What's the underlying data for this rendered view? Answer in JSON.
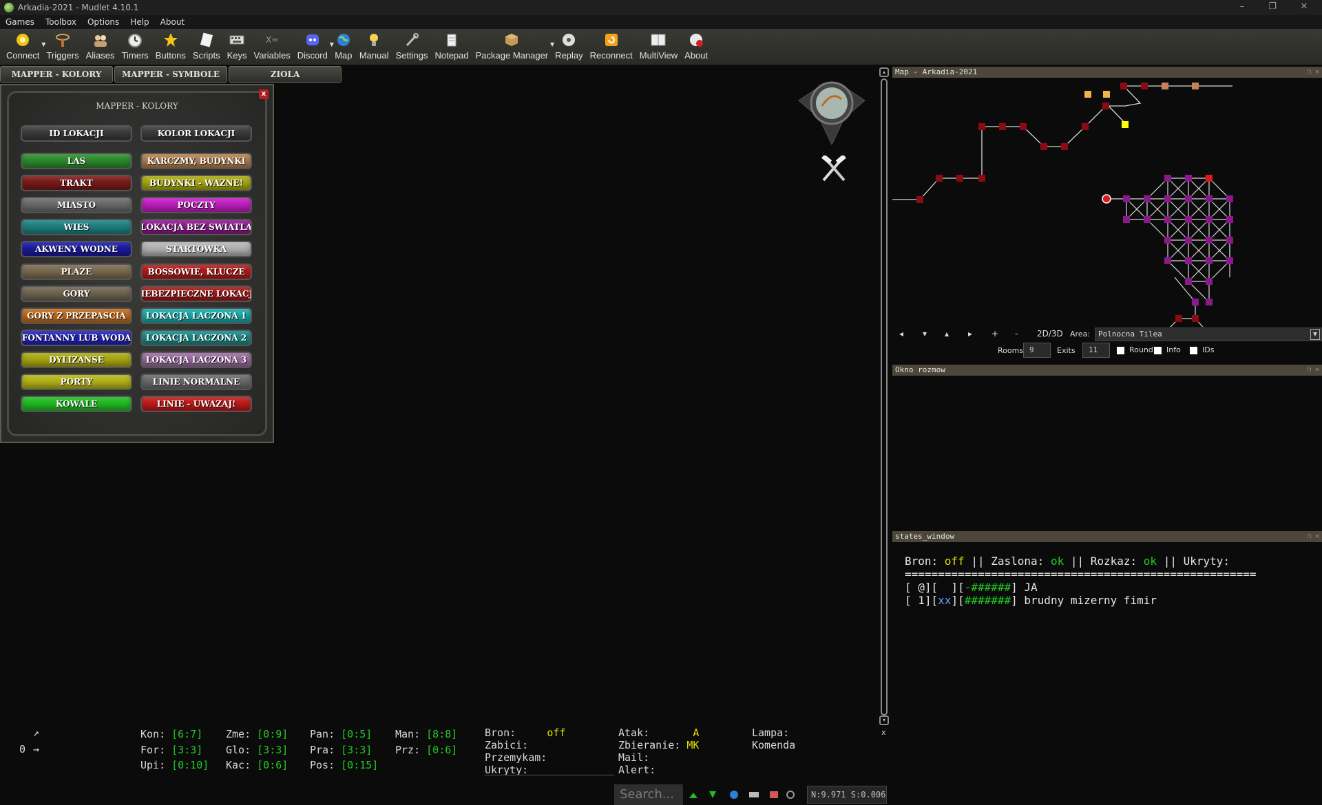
{
  "window": {
    "title": "Arkadia-2021 - Mudlet 4.10.1",
    "minimize": "–",
    "maximize": "❐",
    "close": "✕"
  },
  "menu": [
    "Games",
    "Toolbox",
    "Options",
    "Help",
    "About"
  ],
  "toolbar": [
    {
      "label": "Connect",
      "icon": "connect-icon"
    },
    {
      "label": "Triggers",
      "icon": "triggers-icon"
    },
    {
      "label": "Aliases",
      "icon": "aliases-icon"
    },
    {
      "label": "Timers",
      "icon": "timers-icon"
    },
    {
      "label": "Buttons",
      "icon": "buttons-icon"
    },
    {
      "label": "Scripts",
      "icon": "scripts-icon"
    },
    {
      "label": "Keys",
      "icon": "keys-icon"
    },
    {
      "label": "Variables",
      "icon": "variables-icon"
    },
    {
      "label": "Discord",
      "icon": "discord-icon"
    },
    {
      "label": "Map",
      "icon": "map-icon"
    },
    {
      "label": "Manual",
      "icon": "manual-icon"
    },
    {
      "label": "Settings",
      "icon": "settings-icon"
    },
    {
      "label": "Notepad",
      "icon": "notepad-icon"
    },
    {
      "label": "Package Manager",
      "icon": "package-icon"
    },
    {
      "label": "Replay",
      "icon": "replay-icon"
    },
    {
      "label": "Reconnect",
      "icon": "reconnect-icon"
    },
    {
      "label": "MultiView",
      "icon": "multiview-icon"
    },
    {
      "label": "About",
      "icon": "about-icon"
    }
  ],
  "tabs": [
    "MAPPER - KOLORY",
    "MAPPER - SYMBOLE",
    "ZIOLA"
  ],
  "panel": {
    "title": "MAPPER - KOLORY",
    "close": "x",
    "header_buttons": [
      "ID LOKACJI",
      "KOLOR LOKACJI"
    ],
    "left": [
      {
        "label": "LAS",
        "color": "#2e8b2e"
      },
      {
        "label": "TRAKT",
        "color": "#7a1a1a"
      },
      {
        "label": "MIASTO",
        "color": "#6a6a6a"
      },
      {
        "label": "WIES",
        "color": "#1f8080"
      },
      {
        "label": "AKWENY WODNE",
        "color": "#1a1aa0"
      },
      {
        "label": "PLAZE",
        "color": "#7a6a50"
      },
      {
        "label": "GORY",
        "color": "#6e6452"
      },
      {
        "label": "GORY Z PRZEPASCIA",
        "color": "#c06a1a"
      },
      {
        "label": "FONTANNY LUB WODA",
        "color": "#2222bb"
      },
      {
        "label": "DYLIZANSE",
        "color": "#a8a812"
      },
      {
        "label": "PORTY",
        "color": "#b4b41a"
      },
      {
        "label": "KOWALE",
        "color": "#22bb22"
      }
    ],
    "right": [
      {
        "label": "KARCZMY, BUDYNKI",
        "color": "#b08050"
      },
      {
        "label": "BUDYNKI - WAZNE!",
        "color": "#a8a812"
      },
      {
        "label": "POCZTY",
        "color": "#c01ec0"
      },
      {
        "label": "LOKACJA BEZ SWIATLA",
        "color": "#8a1a8a"
      },
      {
        "label": "STARTOWKA",
        "color": "#b4b4b4"
      },
      {
        "label": "BOSSOWIE, KLUCZE",
        "color": "#b41a1a"
      },
      {
        "label": "NIEBEZPIECZNE LOKACJE",
        "color": "#a01a1a"
      },
      {
        "label": "LOKACJA LACZONA 1",
        "color": "#18a8a8"
      },
      {
        "label": "LOKACJA LACZONA 2",
        "color": "#1a8a8a"
      },
      {
        "label": "LOKACJA LACZONA 3",
        "color": "#9a6aa0"
      },
      {
        "label": "LINIE NORMALNE",
        "color": "#6a6a6a"
      },
      {
        "label": "LINIE - UWAZAJ!",
        "color": "#c01a1a"
      }
    ]
  },
  "map": {
    "title": "Map - Arkadia-2021",
    "nav": [
      "◂",
      "▾",
      "▴",
      "▸",
      "+",
      "-"
    ],
    "mode": "2D/3D",
    "area_label": "Area:",
    "area_value": "Polnocna Tilea",
    "rooms_label": "Rooms",
    "rooms_value": "9",
    "exits_label": "Exits",
    "exits_value": "11",
    "round": "Round",
    "info": "Info",
    "ids": "IDs",
    "room_color_dark_red": "#8b0a14",
    "room_color_purple": "#8a1a8a",
    "room_color_yellow": "#ffff00"
  },
  "chat": {
    "title": "Okno rozmow"
  },
  "states": {
    "title": "states_window",
    "l1_a": "Bron: ",
    "l1_b": "off",
    "l1_c": " || Zaslona: ",
    "l1_d": "ok",
    "l1_e": " || Rozkaz: ",
    "l1_f": "ok",
    "l1_g": " || Ukryty:",
    "separator": "=====================================================",
    "l3_a": "[ @][  ][",
    "l3_b": "-######",
    "l3_c": "] JA",
    "l4_a": "[ 1][",
    "l4_b": "xx",
    "l4_c": "][",
    "l4_d": "#######",
    "l4_e": "] brudny mizerny fimir"
  },
  "status": {
    "compass_arrow": "↗",
    "compass_num": "0",
    "compass_right": "→",
    "stats": [
      [
        {
          "k": "Kon:",
          "v": "[6:7]"
        },
        {
          "k": "Zme:",
          "v": "[0:9]"
        },
        {
          "k": "Pan:",
          "v": "[0:5]"
        },
        {
          "k": "Man:",
          "v": "[8:8]"
        }
      ],
      [
        {
          "k": "For:",
          "v": "[3:3]"
        },
        {
          "k": "Glo:",
          "v": "[3:3]"
        },
        {
          "k": "Pra:",
          "v": "[3:3]"
        },
        {
          "k": "Prz:",
          "v": "[0:6]"
        }
      ],
      [
        {
          "k": "Upi:",
          "v": "[0:10]"
        },
        {
          "k": "Kac:",
          "v": "[0:6]"
        },
        {
          "k": "Pos:",
          "v": "[0:15]"
        }
      ]
    ],
    "col2": [
      "Bron:",
      "Zabici:",
      "Przemykam:",
      "Ukryty:"
    ],
    "bron_val": "off",
    "col3": [
      "Atak:",
      "Zbieranie:",
      "Mail:",
      "Alert:"
    ],
    "atak_val": "A",
    "zbieranie_val": "MK",
    "col4": [
      "Lampa:",
      "Komenda"
    ]
  },
  "search_placeholder": "Search...",
  "netstat": "N:9.971 S:0.006",
  "scroll_close": "x"
}
